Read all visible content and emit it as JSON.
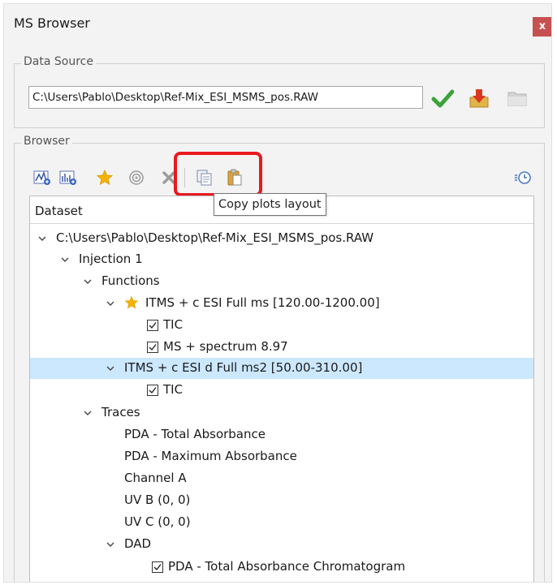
{
  "window": {
    "title": "MS Browser",
    "close_label": "x"
  },
  "data_source": {
    "group_label": "Data Source",
    "path": "C:\\Users\\Pablo\\Desktop\\Ref-Mix_ESI_MSMS_pos.RAW"
  },
  "browser": {
    "group_label": "Browser",
    "tooltip": "Copy plots layout",
    "tree_header": "Dataset",
    "tree": {
      "root": "C:\\Users\\Pablo\\Desktop\\Ref-Mix_ESI_MSMS_pos.RAW",
      "injection": "Injection 1",
      "functions": "Functions",
      "func1": "ITMS + c ESI Full ms [120.00-1200.00]",
      "func1_tic": "TIC",
      "func1_spectrum": "MS + spectrum 8.97",
      "func2": "ITMS + c ESI d Full ms2 [50.00-310.00]",
      "func2_tic": "TIC",
      "traces": "Traces",
      "trace1": "PDA - Total Absorbance",
      "trace2": "PDA - Maximum Absorbance",
      "trace3": "Channel A",
      "trace4": "UV B (0, 0)",
      "trace5": "UV C (0, 0)",
      "dad": "DAD",
      "dad_item": "PDA - Total Absorbance Chromatogram"
    }
  },
  "colors": {
    "accent_close": "#c75050",
    "highlight": "#e8191e",
    "selection": "#cce8ff",
    "checkmark": "#3aa33a",
    "star": "#f5b301"
  }
}
